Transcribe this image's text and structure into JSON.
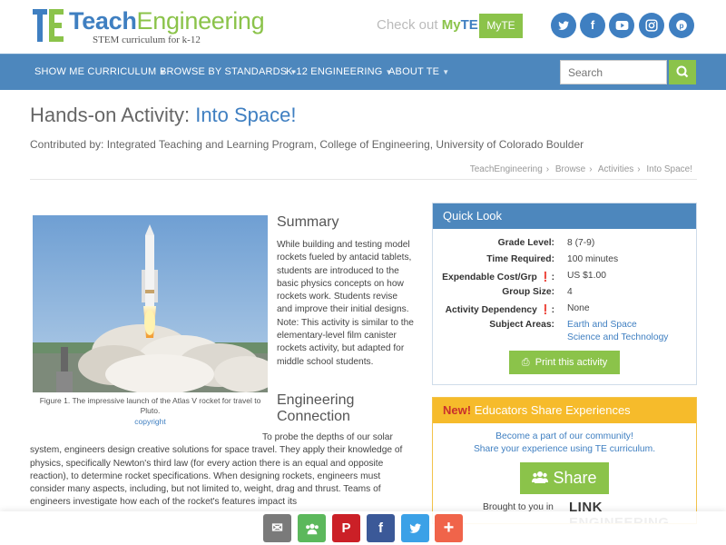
{
  "header": {
    "logo": {
      "brand_part1": "Teach",
      "brand_part2": "Engineering",
      "tagline": "STEM curriculum for k-12"
    },
    "checkout": {
      "prefix": "Check out",
      "my": "My",
      "te": "TE"
    },
    "myte_button": "MyTE",
    "social_icons": [
      "twitter-icon",
      "facebook-icon",
      "youtube-icon",
      "instagram-icon",
      "pinterest-icon"
    ]
  },
  "nav": {
    "items": [
      {
        "label": "SHOW ME CURRICULUM"
      },
      {
        "label": "BROWSE BY STANDARDS"
      },
      {
        "label": "K-12 ENGINEERING"
      },
      {
        "label": "ABOUT TE"
      }
    ],
    "search_placeholder": "Search"
  },
  "page": {
    "title_prefix": "Hands-on Activity:",
    "title_highlight": "Into Space!",
    "contributed": "Contributed by: Integrated Teaching and Learning Program, College of Engineering, University of Colorado Boulder",
    "breadcrumbs": [
      "TeachEngineering",
      "Browse",
      "Activities",
      "Into Space!"
    ]
  },
  "figure": {
    "caption": "Figure 1. The impressive launch of the Atlas V rocket for travel to Pluto.",
    "copyright": "copyright"
  },
  "summary": {
    "heading": "Summary",
    "text": "While building and testing model rockets fueled by antacid tablets, students are introduced to the basic physics concepts on how rockets work. Students revise and improve their initial designs. Note: This activity is similar to the elementary-level film canister rockets activity, but adapted for middle school students."
  },
  "engineering": {
    "heading": "Engineering Connection",
    "text": "To probe the depths of our solar system, engineers design creative solutions for space travel. They apply their knowledge of physics, specifically Newton's third law (for every action there is an equal and opposite reaction), to determine rocket specifications. When designing rockets, engineers must consider many aspects, including, but not limited to, weight, drag and thrust. Teams of engineers investigate how each of the rocket's features impact its"
  },
  "quick_look": {
    "heading": "Quick Look",
    "rows": [
      {
        "label": "Grade Level:",
        "value": "8 (7-9)"
      },
      {
        "label": "Time Required:",
        "value": "100 minutes"
      },
      {
        "label": "Expendable Cost/Grp",
        "value": "US $1.00"
      },
      {
        "label": "Group Size:",
        "value": "4"
      },
      {
        "label": "Activity Dependency",
        "value": "None"
      },
      {
        "label": "Subject Areas:",
        "value": "Earth and Space",
        "value2": "Science and Technology"
      }
    ],
    "print_button": "Print this activity"
  },
  "educators": {
    "new_label": "New!",
    "heading": "Educators Share Experiences",
    "line1": "Become a part of our community!",
    "line2": "Share your experience using TE curriculum.",
    "share_button": "Share",
    "brought": "Brought to you in",
    "sponsor": "LINK ENGINEERING"
  },
  "sharebar": {
    "buttons": [
      {
        "icon": "email-icon",
        "color": "#7a7a7a"
      },
      {
        "icon": "community-icon",
        "color": "#5cb85c"
      },
      {
        "icon": "pinterest-icon",
        "color": "#cb2027"
      },
      {
        "icon": "facebook-icon",
        "color": "#3b5998"
      },
      {
        "icon": "twitter-icon",
        "color": "#3ba1e7"
      },
      {
        "icon": "more-icon",
        "color": "#f0644a"
      }
    ]
  },
  "colors": {
    "brand_blue": "#3f7fc1",
    "brand_green": "#8bc34a",
    "nav_blue": "#4d87bd",
    "accent_orange": "#f6bb2b"
  }
}
